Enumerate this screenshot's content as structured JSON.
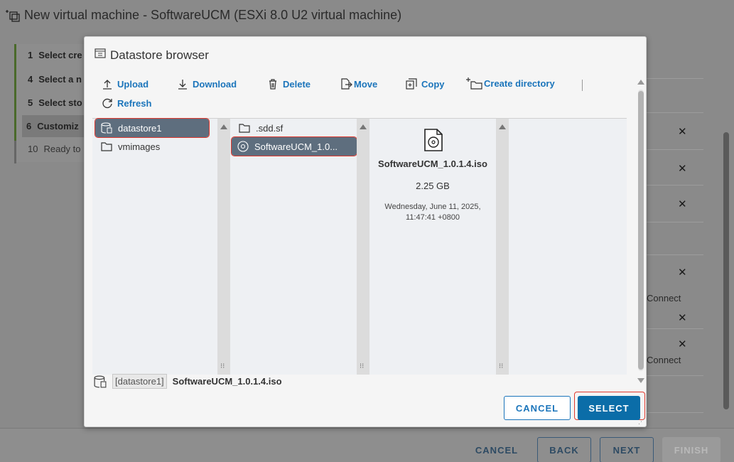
{
  "background": {
    "title": "New virtual machine - SoftwareUCM (ESXi 8.0 U2 virtual machine)",
    "steps": [
      {
        "num": "1",
        "label": "Select cre"
      },
      {
        "num": "4",
        "label": "Select a n"
      },
      {
        "num": "5",
        "label": "Select sto"
      },
      {
        "num": "6",
        "label": "Customiz"
      },
      {
        "num": "10",
        "label": "Ready to"
      }
    ],
    "right_connect_1": "Connect",
    "right_connect_2": "Connect",
    "footer": {
      "cancel": "CANCEL",
      "back": "BACK",
      "next": "NEXT",
      "finish": "FINISH"
    }
  },
  "dialog": {
    "title": "Datastore browser",
    "toolbar": {
      "upload": "Upload",
      "download": "Download",
      "delete": "Delete",
      "move": "Move",
      "copy": "Copy",
      "create_directory": "Create directory",
      "refresh": "Refresh"
    },
    "pane1": [
      "datastore1",
      "vmimages"
    ],
    "pane2": [
      ".sdd.sf",
      "SoftwareUCM_1.0..."
    ],
    "details": {
      "name": "SoftwareUCM_1.0.1.4.iso",
      "size": "2.25 GB",
      "date_line1": "Wednesday, June 11, 2025,",
      "date_line2": "11:47:41 +0800"
    },
    "path": {
      "datastore": "[datastore1]",
      "file": "SoftwareUCM_1.0.1.4.iso"
    },
    "buttons": {
      "cancel": "CANCEL",
      "select": "SELECT"
    }
  }
}
